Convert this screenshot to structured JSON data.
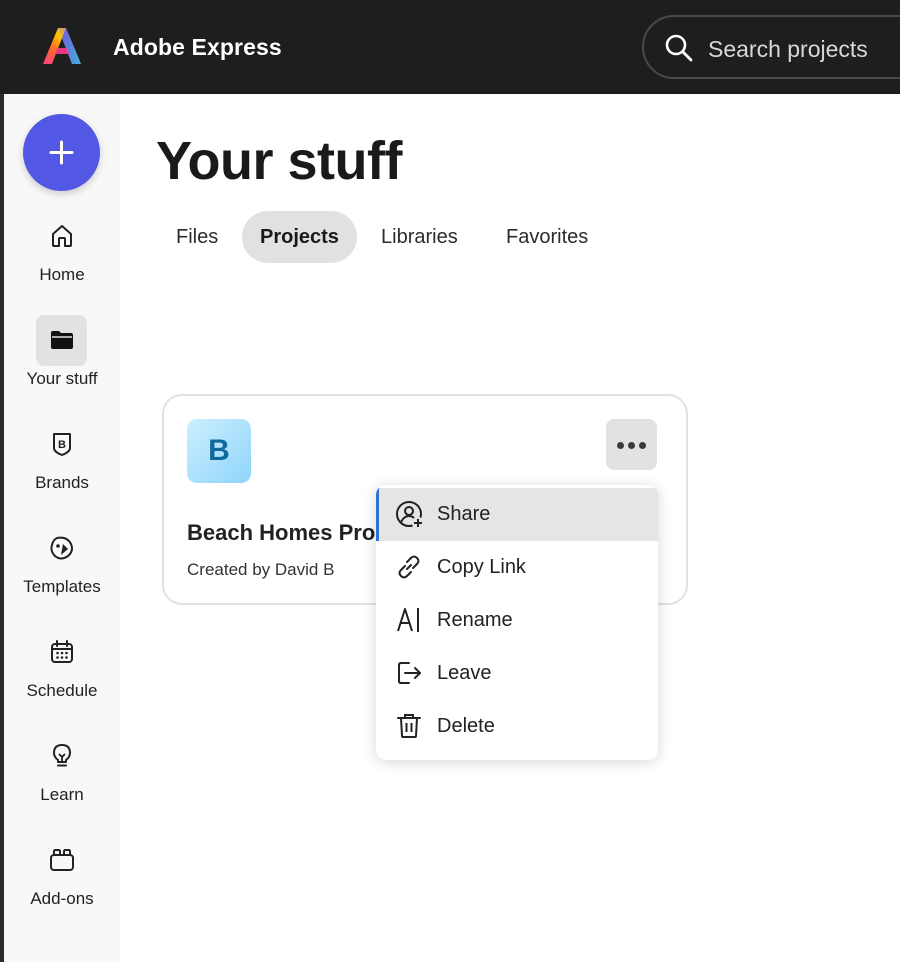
{
  "app": {
    "name": "Adobe Express",
    "logo_icon": "adobe-express-logo-icon"
  },
  "search": {
    "placeholder": "Search projects",
    "icon": "search-icon"
  },
  "create_button": {
    "icon": "plus-icon"
  },
  "sidebar": {
    "items": [
      {
        "label": "Home",
        "icon": "home-icon",
        "active": false
      },
      {
        "label": "Your stuff",
        "icon": "folder-icon",
        "active": true
      },
      {
        "label": "Brands",
        "icon": "brand-icon",
        "active": false
      },
      {
        "label": "Templates",
        "icon": "templates-icon",
        "active": false
      },
      {
        "label": "Schedule",
        "icon": "calendar-icon",
        "active": false
      },
      {
        "label": "Learn",
        "icon": "lightbulb-icon",
        "active": false
      },
      {
        "label": "Add-ons",
        "icon": "addons-icon",
        "active": false
      }
    ]
  },
  "main": {
    "title": "Your stuff",
    "tabs": [
      {
        "label": "Files",
        "active": false
      },
      {
        "label": "Projects",
        "active": true
      },
      {
        "label": "Libraries",
        "active": false
      },
      {
        "label": "Favorites",
        "active": false
      }
    ]
  },
  "project_card": {
    "avatar_letter": "B",
    "title": "Beach Homes Pro",
    "subtitle": "Created by David B",
    "more_icon": "more-options-icon"
  },
  "context_menu": {
    "items": [
      {
        "label": "Share",
        "icon": "share-user-icon",
        "highlighted": true
      },
      {
        "label": "Copy Link",
        "icon": "link-icon",
        "highlighted": false
      },
      {
        "label": "Rename",
        "icon": "rename-icon",
        "highlighted": false
      },
      {
        "label": "Leave",
        "icon": "leave-icon",
        "highlighted": false
      },
      {
        "label": "Delete",
        "icon": "trash-icon",
        "highlighted": false
      }
    ]
  },
  "colors": {
    "accent": "#5258e4",
    "topbar": "#1e1e1e",
    "menu_focus": "#2e73d3",
    "avatar_text": "#0f6a9b"
  }
}
